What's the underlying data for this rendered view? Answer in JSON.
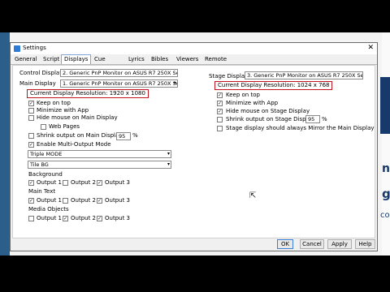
{
  "window": {
    "title": "Settings",
    "close": "✕"
  },
  "tabs": [
    "General",
    "Script",
    "Displays",
    "Cue Setup",
    "Lyrics",
    "Bibles",
    "Viewers",
    "Remote"
  ],
  "left": {
    "control_display_label": "Control Display",
    "control_display_value": "2. Generic PnP Monitor on ASUS R7 250X Ser",
    "main_display_label": "Main Display",
    "main_display_value": "1. Generic PnP Monitor on ASUS R7 250X Se",
    "resolution": "Current Display Resolution: 1920 x 1080",
    "keep_on_top": "Keep on top",
    "minimize_with_app": "Minimize with App",
    "hide_mouse": "Hide mouse on Main Display",
    "web_pages": "Web Pages",
    "shrink_output": "Shrink output on Main Display",
    "shrink_value": "95",
    "shrink_unit": "%",
    "enable_multi": "Enable Multi-Output Mode",
    "mode_value": "Triple MODE",
    "tile_value": "Tile BG",
    "background_label": "Background",
    "main_text_label": "Main Text",
    "media_objects_label": "Media Objects",
    "output1": "Output 1",
    "output2": "Output 2",
    "output3": "Output 3"
  },
  "right": {
    "stage_display_label": "Stage Display",
    "stage_display_value": "3. Generic PnP Monitor on ASUS R7 250X Seri",
    "resolution": "Current Display Resolution: 1024 x 768",
    "keep_on_top": "Keep on top",
    "minimize_with_app": "Minimize with App",
    "hide_mouse": "Hide mouse on Stage Display",
    "shrink_output": "Shrink output on Stage Display",
    "shrink_value": "95",
    "shrink_unit": "%",
    "mirror": "Stage display should always Mirror the Main Display"
  },
  "buttons": {
    "ok": "OK",
    "cancel": "Cancel",
    "apply": "Apply",
    "help": "Help"
  },
  "background_text": {
    "letter_g": "g",
    "letter_n": "n",
    "co": "co"
  }
}
